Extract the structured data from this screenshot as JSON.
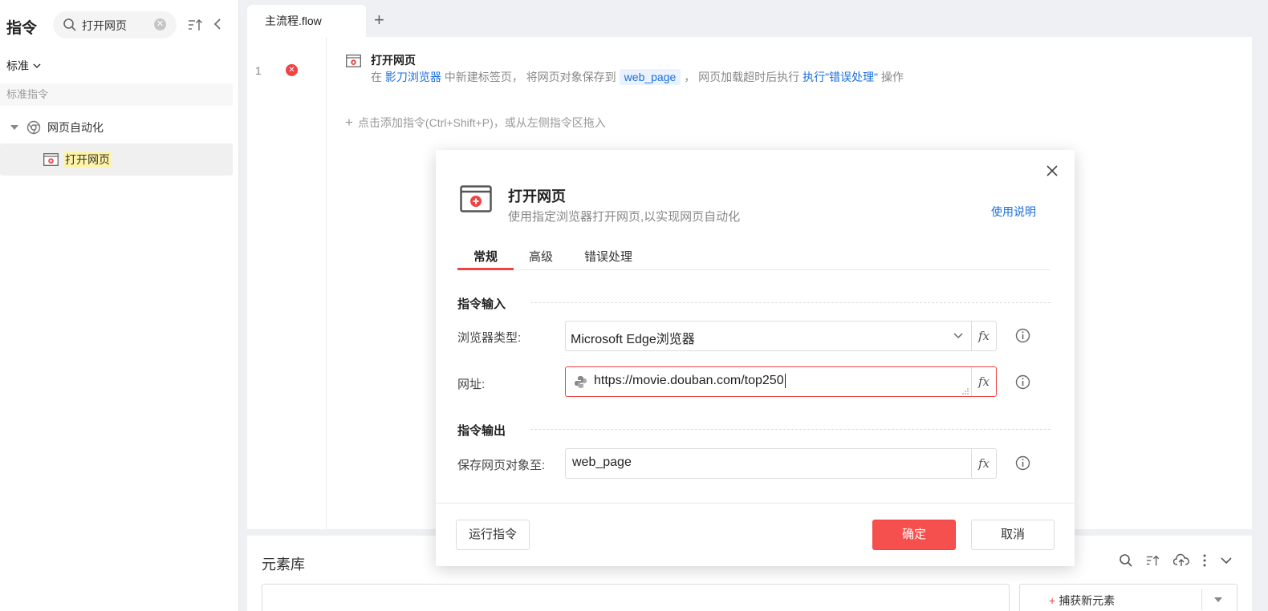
{
  "sidebar": {
    "title": "指令",
    "search_value": "打开网页",
    "category_dropdown": "标准",
    "section_label": "标准指令",
    "group_label": "网页自动化",
    "item_label": "打开网页"
  },
  "editor": {
    "tab_label": "主流程.flow",
    "line_number": "1",
    "command_title": "打开网页",
    "desc_prefix": "在",
    "desc_browser": "影刀浏览器",
    "desc_mid": "中新建标签页，  将网页对象保存到",
    "desc_var": "web_page",
    "desc_mid2": "，  网页加载超时后执行",
    "desc_action": "执行\"错误处理\"",
    "desc_suffix": "操作",
    "add_hint": "点击添加指令(Ctrl+Shift+P)，或从左侧指令区拖入"
  },
  "element_library": {
    "title": "元素库",
    "capture_label": "捕获新元素"
  },
  "dialog": {
    "title": "打开网页",
    "subtitle": "使用指定浏览器打开网页,以实现网页自动化",
    "help_link": "使用说明",
    "tabs": [
      "常规",
      "高级",
      "错误处理"
    ],
    "input_section": "指令输入",
    "output_section": "指令输出",
    "browser_label": "浏览器类型:",
    "browser_value": "Microsoft Edge浏览器",
    "url_label": "网址:",
    "url_value": "https://movie.douban.com/top250",
    "save_label": "保存网页对象至:",
    "save_value": "web_page",
    "fx_label": "fx",
    "run_button": "运行指令",
    "ok_button": "确定",
    "cancel_button": "取消"
  },
  "colors": {
    "accent_red": "#f04444",
    "link_blue": "#1b6fe0"
  }
}
